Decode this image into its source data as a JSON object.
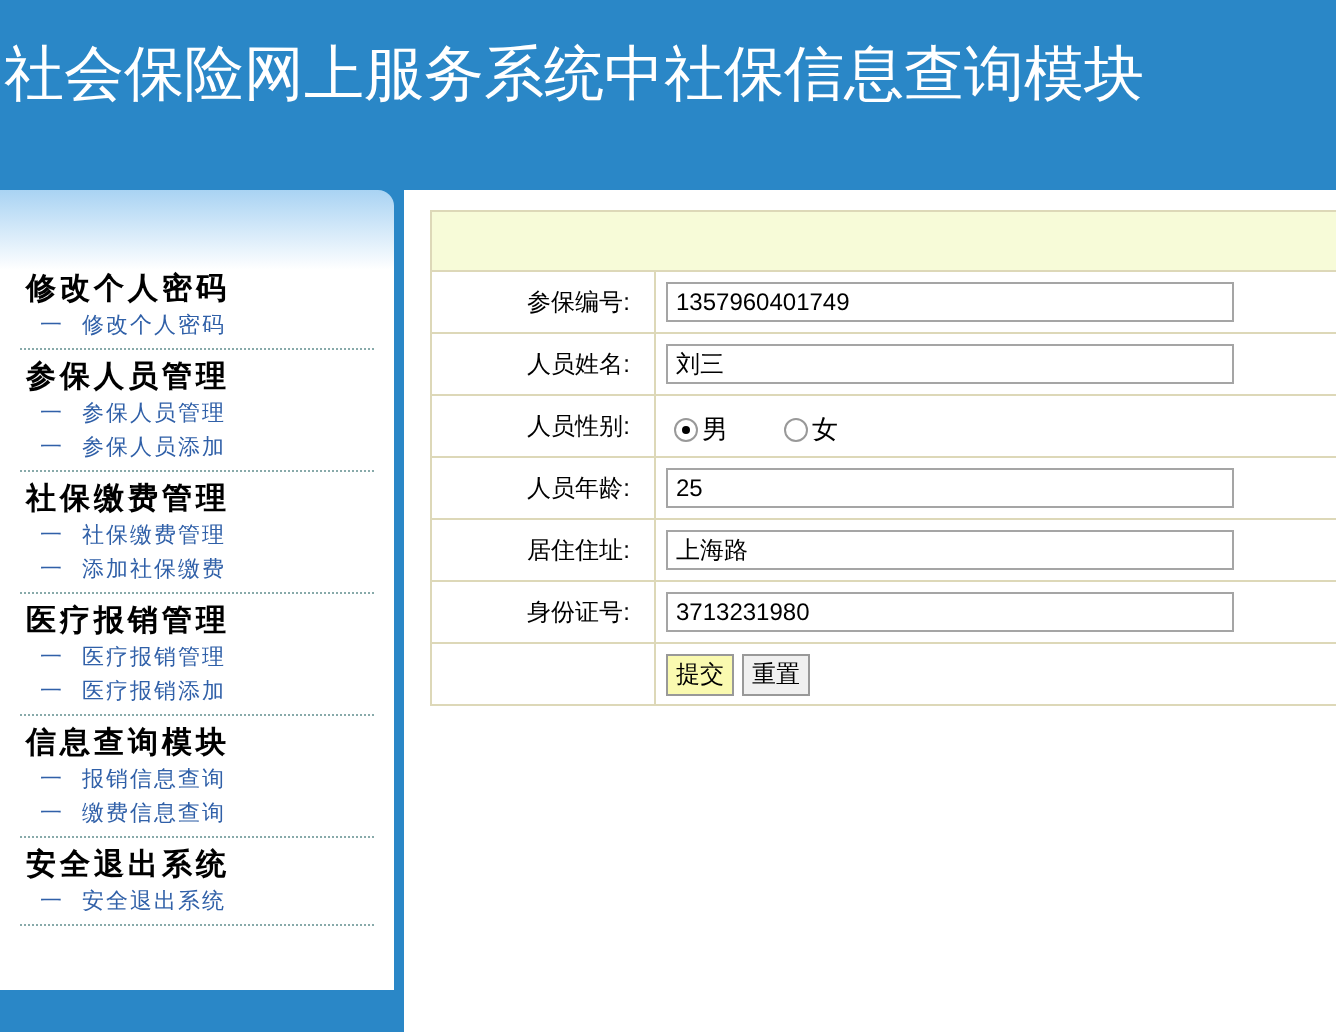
{
  "header": {
    "title": "社会保险网上服务系统中社保信息查询模块"
  },
  "sidebar": {
    "groups": [
      {
        "title": "修改个人密码",
        "items": [
          {
            "bullet": "一",
            "label": "修改个人密码"
          }
        ]
      },
      {
        "title": "参保人员管理",
        "items": [
          {
            "bullet": "一",
            "label": "参保人员管理"
          },
          {
            "bullet": "一",
            "label": "参保人员添加"
          }
        ]
      },
      {
        "title": "社保缴费管理",
        "items": [
          {
            "bullet": "一",
            "label": "社保缴费管理"
          },
          {
            "bullet": "一",
            "label": "添加社保缴费"
          }
        ]
      },
      {
        "title": "医疗报销管理",
        "items": [
          {
            "bullet": "一",
            "label": "医疗报销管理"
          },
          {
            "bullet": "一",
            "label": "医疗报销添加"
          }
        ]
      },
      {
        "title": "信息查询模块",
        "items": [
          {
            "bullet": "一",
            "label": "报销信息查询"
          },
          {
            "bullet": "一",
            "label": "缴费信息查询"
          }
        ]
      },
      {
        "title": "安全退出系统",
        "items": [
          {
            "bullet": "一",
            "label": "安全退出系统"
          }
        ]
      }
    ]
  },
  "form": {
    "rows": [
      {
        "kind": "text",
        "label": "参保编号:",
        "value": "1357960401749"
      },
      {
        "kind": "text",
        "label": "人员姓名:",
        "value": "刘三"
      },
      {
        "kind": "radio",
        "label": "人员性别:",
        "options": [
          {
            "label": "男",
            "selected": true
          },
          {
            "label": "女",
            "selected": false
          }
        ]
      },
      {
        "kind": "text",
        "label": "人员年龄:",
        "value": "25"
      },
      {
        "kind": "text",
        "label": "居住住址:",
        "value": "上海路"
      },
      {
        "kind": "text",
        "label": "身份证号:",
        "value": "3713231980"
      },
      {
        "kind": "buttons",
        "buttons": [
          {
            "label": "提交",
            "highlighted": true
          },
          {
            "label": "重置",
            "highlighted": false
          }
        ]
      }
    ]
  }
}
